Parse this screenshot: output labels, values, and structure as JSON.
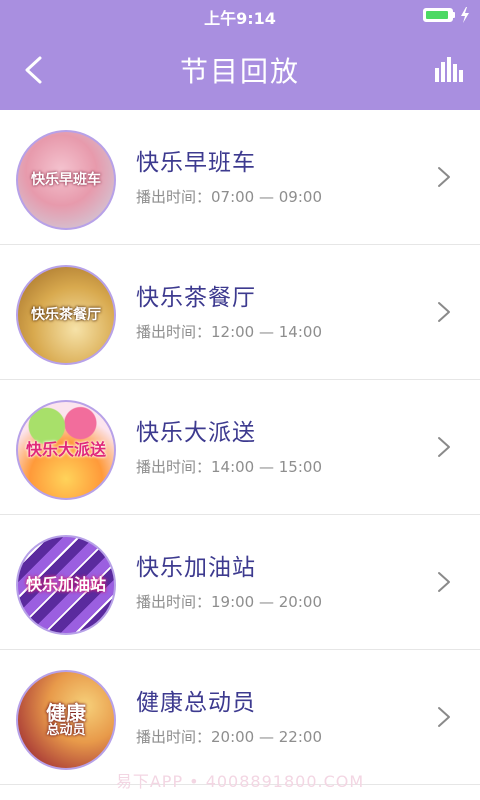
{
  "status_bar": {
    "time": "上午9:14",
    "battery_icon": "battery-full-icon",
    "charging_icon": "charging-bolt-icon"
  },
  "nav": {
    "title": "节目回放",
    "back_icon": "chevron-left-icon",
    "stats_icon": "bar-chart-icon"
  },
  "colors": {
    "header_bg": "#a98fe0",
    "title_text": "#3d3a8f",
    "time_text": "#8e8e8e",
    "battery_green": "#4cd964"
  },
  "programs": [
    {
      "title": "快乐早班车",
      "time": "播出时间：07:00 — 09:00",
      "thumb_label": "快乐早班车"
    },
    {
      "title": "快乐茶餐厅",
      "time": "播出时间：12:00 — 14:00",
      "thumb_label": "快乐茶餐厅"
    },
    {
      "title": "快乐大派送",
      "time": "播出时间：14:00 — 15:00",
      "thumb_label": "快乐大派送"
    },
    {
      "title": "快乐加油站",
      "time": "播出时间：19:00 — 20:00",
      "thumb_label": "快乐加油站"
    },
    {
      "title": "健康总动员",
      "time": "播出时间：20:00 — 22:00",
      "thumb_label_line1": "健康",
      "thumb_label_line2": "总动员"
    }
  ],
  "watermark": "易下APP • 4008891800.COM"
}
